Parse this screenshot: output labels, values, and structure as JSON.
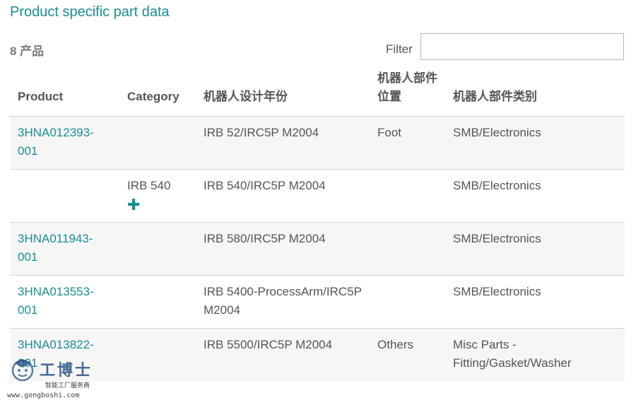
{
  "page": {
    "title": "Product specific part data",
    "count": "8 产品",
    "filter_label": "Filter",
    "filter_value": ""
  },
  "table": {
    "headers": [
      "Product",
      "Category",
      "机器人设计年份",
      "机器人部件位置",
      "机器人部件类别"
    ],
    "rows": [
      {
        "product": "3HNA012393-001",
        "category": "",
        "design": "IRB 52/IRC5P M2004",
        "position": "Foot",
        "type": "SMB/Electronics"
      },
      {
        "product": "",
        "category": "IRB 540",
        "design": "IRB 540/IRC5P M2004",
        "position": "",
        "type": "SMB/Electronics"
      },
      {
        "product": "3HNA011943-001",
        "category": "",
        "design": "IRB 580/IRC5P M2004",
        "position": "",
        "type": "SMB/Electronics"
      },
      {
        "product": "3HNA013553-001",
        "category": "",
        "design": "IRB 5400-ProcessArm/IRC5P M2004",
        "position": "",
        "type": "SMB/Electronics"
      },
      {
        "product": "3HNA013822-001",
        "category": "",
        "design": "IRB 5500/IRC5P M2004",
        "position": "Others",
        "type": "Misc Parts - Fitting/Gasket/Washer"
      }
    ]
  },
  "expand_icon": "plus-icon",
  "colors": {
    "accent": "#1a8c96",
    "text": "#555555",
    "stripe": "#f6f6f6"
  },
  "watermark": {
    "name": "工博士",
    "tagline": "智能工厂服务商",
    "url": "www.gongboshi.com"
  }
}
